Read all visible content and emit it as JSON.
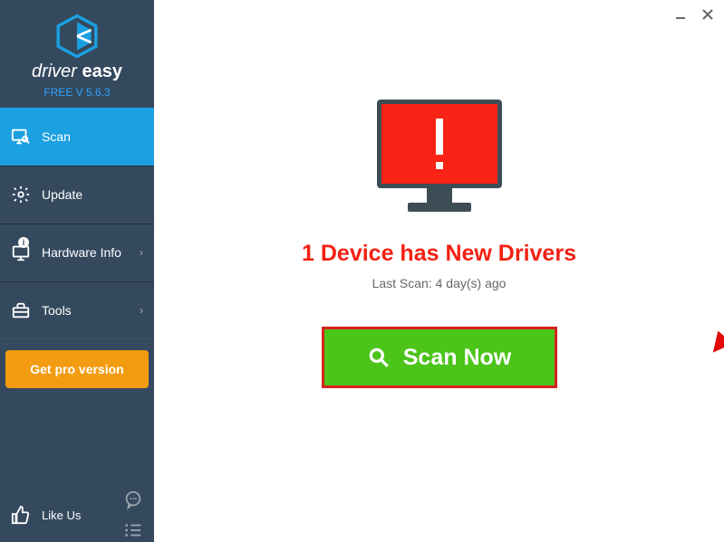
{
  "brand": {
    "name": "driver easy",
    "version": "FREE V 5.6.3"
  },
  "sidebar": {
    "items": [
      {
        "label": "Scan",
        "icon": "monitor-search-icon",
        "active": true,
        "arrow": false
      },
      {
        "label": "Update",
        "icon": "gear-icon",
        "active": false,
        "arrow": false
      },
      {
        "label": "Hardware Info",
        "icon": "pc-badge-icon",
        "active": false,
        "arrow": true
      },
      {
        "label": "Tools",
        "icon": "toolbox-icon",
        "active": false,
        "arrow": true
      }
    ],
    "cta_label": "Get pro version",
    "like_label": "Like Us"
  },
  "main": {
    "heading": "1 Device has New Drivers",
    "last_scan": "Last Scan: 4 day(s) ago",
    "scan_label": "Scan Now"
  },
  "annotation": {
    "arrow_color": "#e30a0a"
  }
}
